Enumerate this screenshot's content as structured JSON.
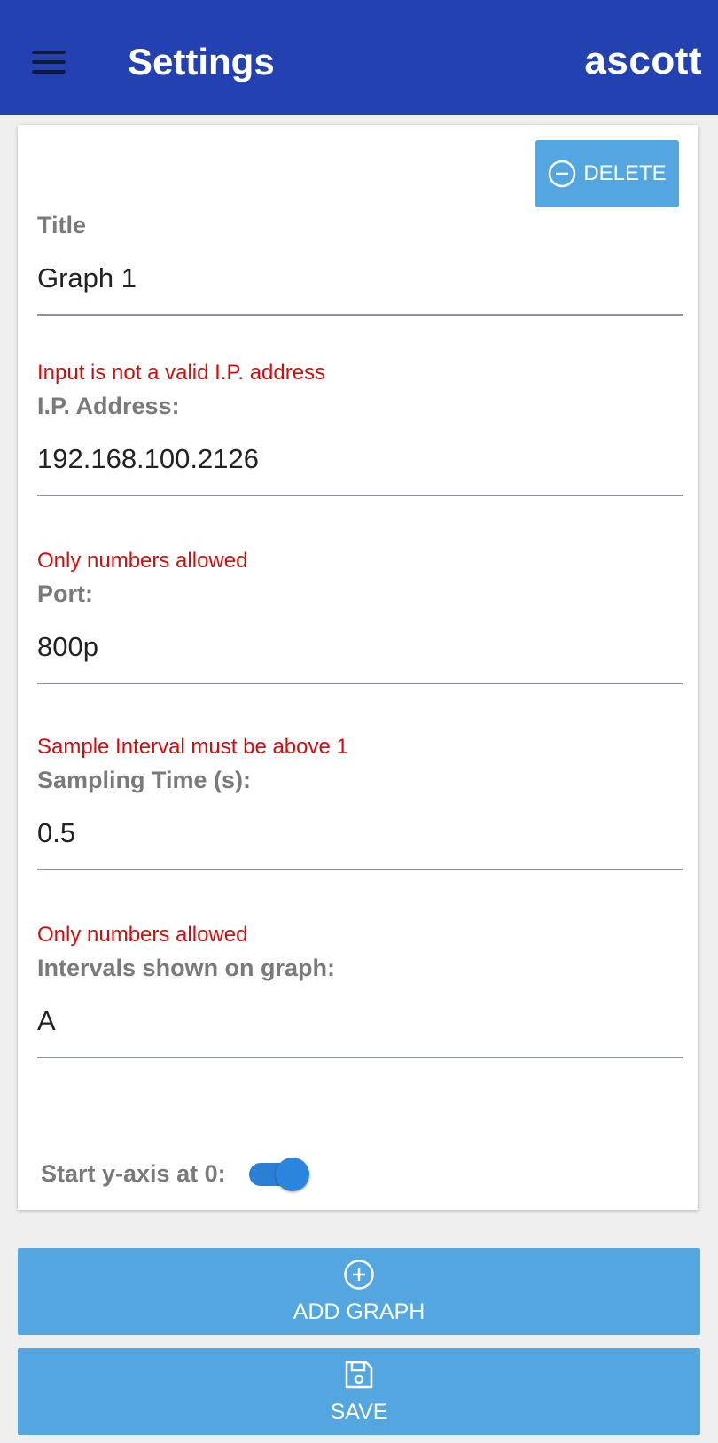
{
  "appbar": {
    "title": "Settings",
    "brand": "ascott",
    "menu_icon": "hamburger-menu-icon"
  },
  "card": {
    "delete_label": "DELETE",
    "delete_icon": "minus-circle-icon",
    "fields": {
      "title": {
        "label": "Title",
        "value": "Graph 1",
        "error": ""
      },
      "ip": {
        "label": "I.P. Address:",
        "value": "192.168.100.2126",
        "error": "Input is not a valid I.P. address"
      },
      "port": {
        "label": "Port:",
        "value": "800p",
        "error": "Only numbers allowed"
      },
      "sampling": {
        "label": "Sampling Time (s):",
        "value": "0.5",
        "error": "Sample Interval must be above 1"
      },
      "intervals": {
        "label": "Intervals shown on graph:",
        "value": "A",
        "error": "Only numbers allowed"
      }
    },
    "toggle": {
      "label": "Start y-axis at 0:",
      "on": true
    }
  },
  "actions": {
    "add_graph_label": "ADD GRAPH",
    "add_graph_icon": "plus-circle-icon",
    "save_label": "SAVE",
    "save_icon": "floppy-disk-icon"
  },
  "colors": {
    "appbar": "#2341b0",
    "button": "#54a6e0",
    "error": "#d40c0c",
    "toggle": "#2a7fd4"
  }
}
